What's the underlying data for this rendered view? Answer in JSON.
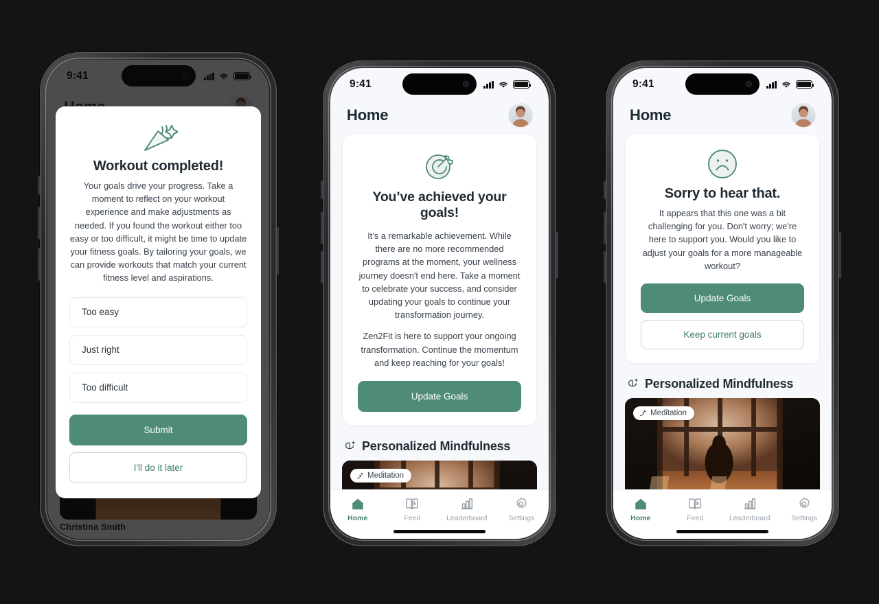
{
  "background_color": "#141414",
  "accent_color": "#4e8b78",
  "accent_text_color": "#3f7a68",
  "screen_bg": "#f6f8fc",
  "status_bar": {
    "time": "9:41",
    "signal_icon": "cellular-signal-icon",
    "wifi_icon": "wifi-icon",
    "battery_icon": "battery-icon"
  },
  "header": {
    "title": "Home",
    "avatar_name": "user-avatar"
  },
  "phone1": {
    "name": "workout-completed-modal-screen",
    "ghost_text": "Christina Smith",
    "modal": {
      "icon": "party-popper-icon",
      "title": "Workout completed!",
      "body": "Your goals drive your progress. Take a moment to reflect on your workout experience and make adjustments as needed. If you found the workout either too easy or too difficult, it might be time to update your fitness goals. By tailoring your goals, we can provide workouts that match your current fitness level and aspirations.",
      "options": [
        {
          "label": "Too easy"
        },
        {
          "label": "Just right"
        },
        {
          "label": "Too difficult"
        }
      ],
      "primary_button": "Submit",
      "secondary_button": "I'll do it later"
    }
  },
  "phone2": {
    "name": "goals-achieved-screen",
    "card": {
      "icon": "target-goal-icon",
      "title": "You’ve achieved your goals!",
      "body1": "It’s a remarkable achievement. While there are no more recommended programs at the moment, your wellness journey doesn't end here. Take a moment to celebrate your success, and consider updating your goals to continue your transformation journey.",
      "body2": "Zen2Fit is here to support your ongoing transformation. Continue the momentum and keep reaching for your goals!",
      "primary_button": "Update Goals"
    },
    "section": {
      "icon": "mindfulness-brain-sparkle-icon",
      "title": "Personalized Mindfulness",
      "media_badge": "Meditation",
      "media_badge_icon": "leaf-icon",
      "media_alt": "meditation-photo"
    }
  },
  "phone3": {
    "name": "sorry-to-hear-that-screen",
    "card": {
      "icon": "sad-face-icon",
      "title": "Sorry to hear that.",
      "body": "It appears that this one was a bit challenging for you. Don't worry; we're here to support you. Would you like to adjust your goals for a more manageable workout?",
      "primary_button": "Update Goals",
      "secondary_button": "Keep current goals"
    },
    "section": {
      "icon": "mindfulness-brain-sparkle-icon",
      "title": "Personalized Mindfulness",
      "media_badge": "Meditation",
      "media_badge_icon": "leaf-icon",
      "media_alt": "meditation-photo"
    }
  },
  "tabbar": {
    "items": [
      {
        "label": "Home",
        "icon": "home-icon",
        "active": true
      },
      {
        "label": "Feed",
        "icon": "feed-book-icon",
        "active": false
      },
      {
        "label": "Leaderboard",
        "icon": "bar-chart-icon",
        "active": false
      },
      {
        "label": "Settings",
        "icon": "gear-icon",
        "active": false
      }
    ]
  }
}
